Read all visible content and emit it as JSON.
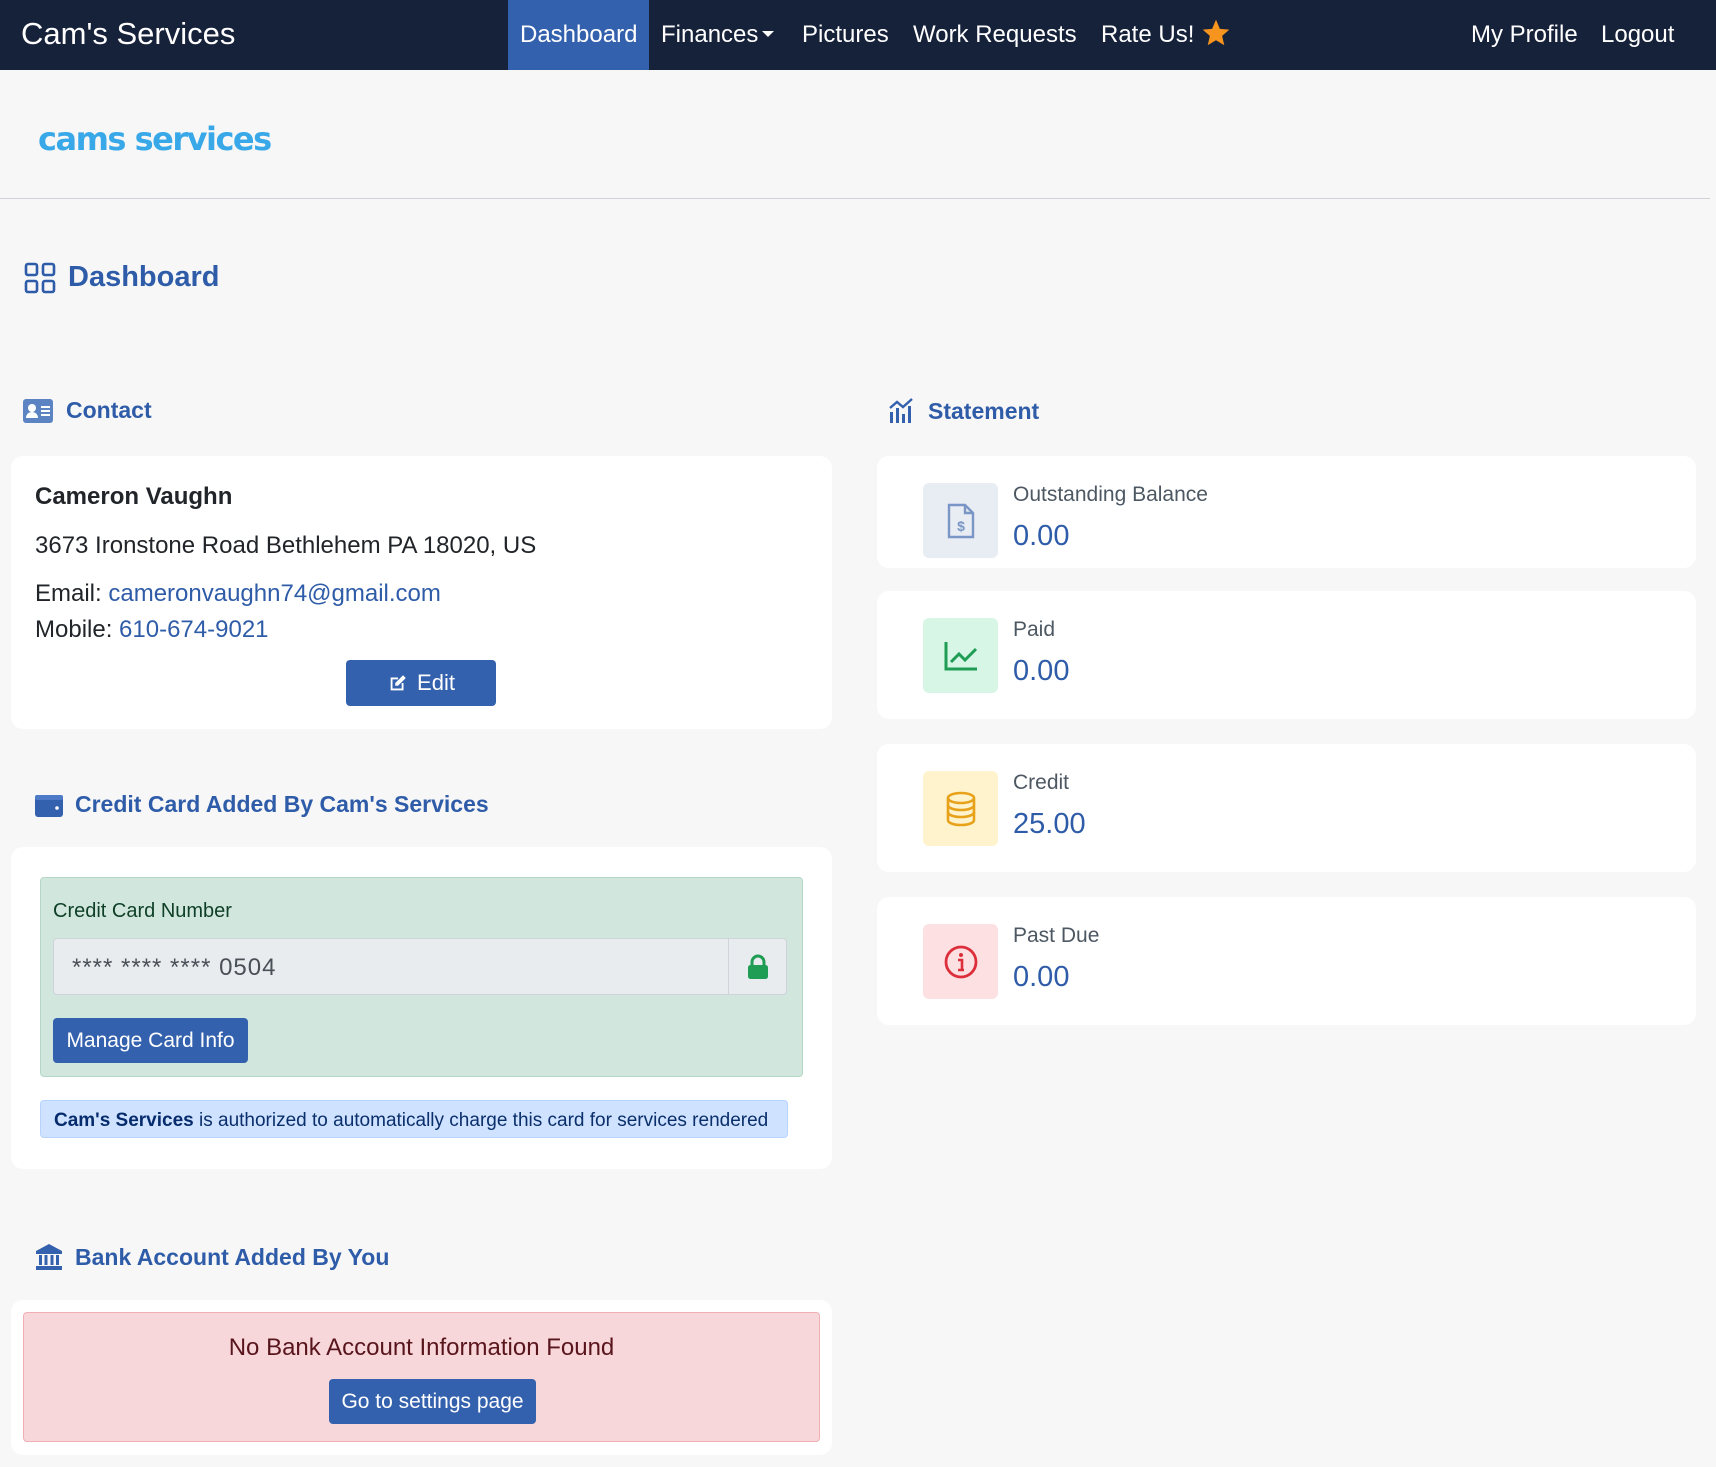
{
  "navbar": {
    "brand": "Cam's Services",
    "items": [
      {
        "label": "Dashboard",
        "active": true
      },
      {
        "label": "Finances",
        "dropdown": true
      },
      {
        "label": "Pictures"
      },
      {
        "label": "Work Requests"
      },
      {
        "label": "Rate Us!",
        "icon": "star-icon"
      }
    ],
    "right": [
      {
        "label": "My Profile"
      },
      {
        "label": "Logout"
      }
    ]
  },
  "logo_text": "cams services",
  "page_title": "Dashboard",
  "contact": {
    "title": "Contact",
    "name": "Cameron Vaughn",
    "address": "3673 Ironstone Road Bethlehem PA 18020, US",
    "email_label": "Email:",
    "email": "cameronvaughn74@gmail.com",
    "mobile_label": "Mobile:",
    "mobile": "610-674-9021",
    "edit_label": "Edit"
  },
  "credit_card": {
    "title": "Credit Card Added By Cam's Services",
    "number_label": "Credit Card Number",
    "masked_number": "****  ****  **** 0504",
    "manage_label": "Manage Card Info",
    "notice_company": "Cam's Services",
    "notice_text": " is authorized to automatically charge this card for services rendered"
  },
  "bank": {
    "title": "Bank Account Added By You",
    "message": "No Bank Account Information Found",
    "button_label": "Go to settings page"
  },
  "statement": {
    "title": "Statement",
    "items": [
      {
        "label": "Outstanding Balance",
        "value": "0.00",
        "icon": "invoice-icon",
        "bg": "#e8ecf3",
        "color": "#7a96c6"
      },
      {
        "label": "Paid",
        "value": "0.00",
        "icon": "chart-line-icon",
        "bg": "#d7f6e6",
        "color": "#1f9d55"
      },
      {
        "label": "Credit",
        "value": "25.00",
        "icon": "coins-icon",
        "bg": "#fef3cd",
        "color": "#e8a21a"
      },
      {
        "label": "Past Due",
        "value": "0.00",
        "icon": "info-icon",
        "bg": "#fde0e2",
        "color": "#dc2f3b"
      }
    ]
  },
  "colors": {
    "navbar_bg": "#16213a",
    "accent": "#3461ad",
    "heading": "#2f5ca8"
  }
}
